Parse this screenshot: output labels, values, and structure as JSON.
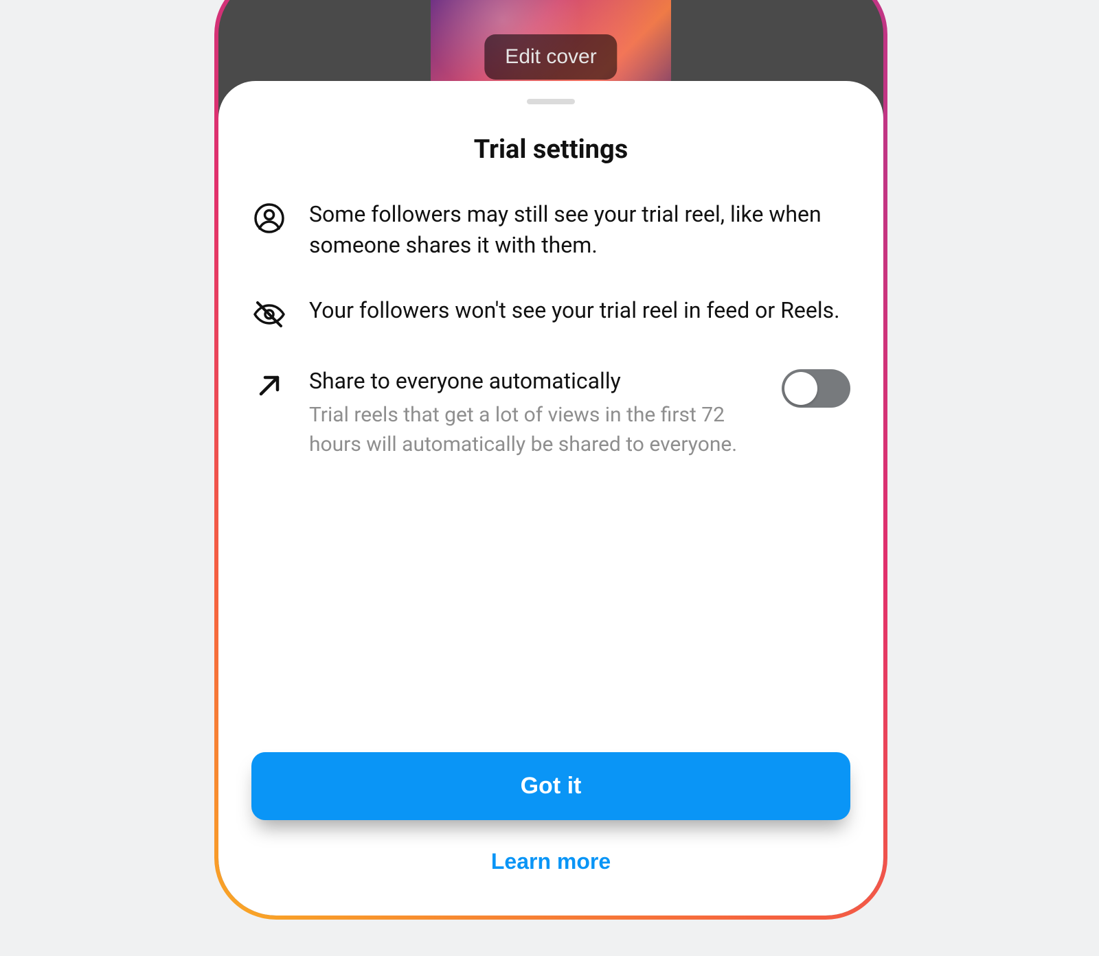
{
  "background": {
    "edit_cover_label": "Edit cover"
  },
  "sheet": {
    "title": "Trial settings",
    "rows": [
      {
        "text": "Some followers may still see your trial reel, like when someone shares it with them."
      },
      {
        "text": "Your followers won't see your trial reel in feed or Reels."
      },
      {
        "heading": "Share to everyone automatically",
        "subtext": "Trial reels that get a lot of views in the first 72 hours will automatically be shared to everyone.",
        "toggle_on": false
      }
    ],
    "primary_button": "Got it",
    "link": "Learn more"
  },
  "colors": {
    "accent": "#0a95f6",
    "muted": "#8e8e8e",
    "toggle_off": "#777a7d"
  }
}
